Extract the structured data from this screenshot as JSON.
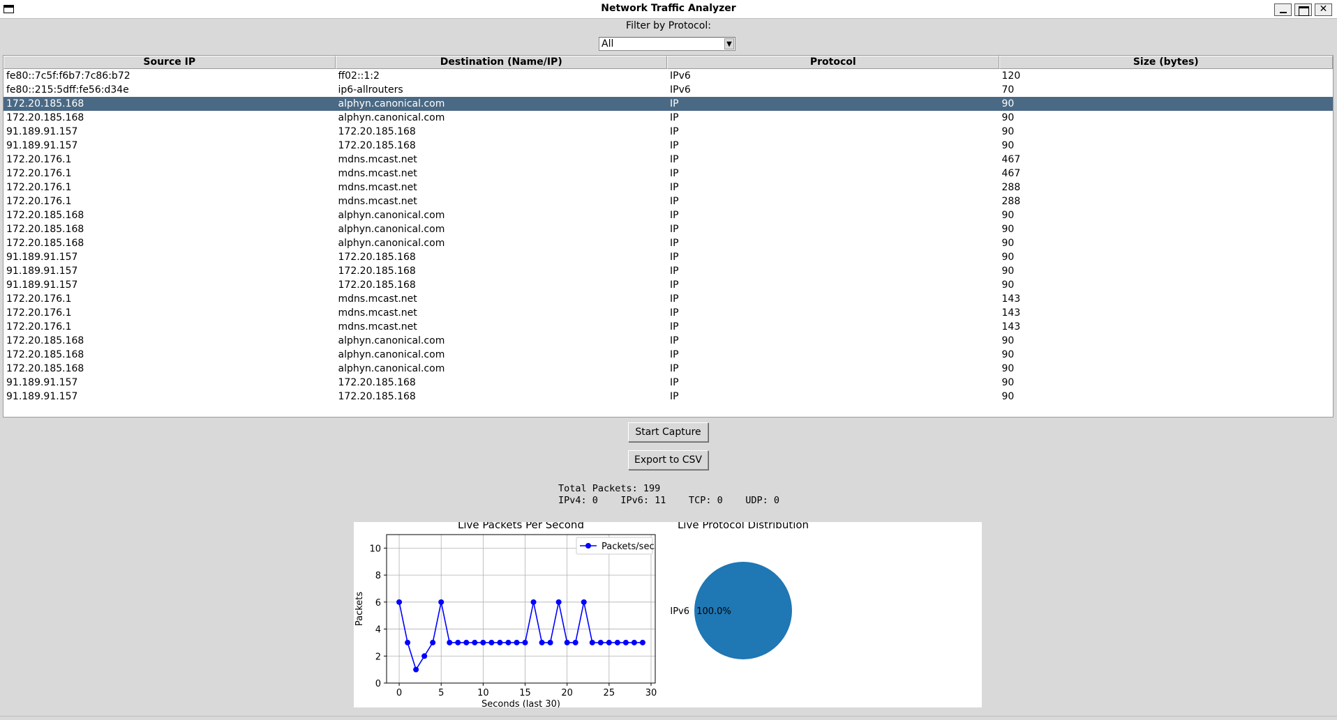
{
  "window": {
    "title": "Network Traffic Analyzer"
  },
  "filter": {
    "label": "Filter by Protocol:",
    "selected": "All"
  },
  "table": {
    "columns": [
      "Source IP",
      "Destination (Name/IP)",
      "Protocol",
      "Size (bytes)"
    ],
    "selected_row": 2,
    "rows": [
      [
        "fe80::7c5f:f6b7:7c86:b72",
        "ff02::1:2",
        "IPv6",
        "120"
      ],
      [
        "fe80::215:5dff:fe56:d34e",
        "ip6-allrouters",
        "IPv6",
        "70"
      ],
      [
        "172.20.185.168",
        "alphyn.canonical.com",
        "IP",
        "90"
      ],
      [
        "172.20.185.168",
        "alphyn.canonical.com",
        "IP",
        "90"
      ],
      [
        "91.189.91.157",
        "172.20.185.168",
        "IP",
        "90"
      ],
      [
        "91.189.91.157",
        "172.20.185.168",
        "IP",
        "90"
      ],
      [
        "172.20.176.1",
        "mdns.mcast.net",
        "IP",
        "467"
      ],
      [
        "172.20.176.1",
        "mdns.mcast.net",
        "IP",
        "467"
      ],
      [
        "172.20.176.1",
        "mdns.mcast.net",
        "IP",
        "288"
      ],
      [
        "172.20.176.1",
        "mdns.mcast.net",
        "IP",
        "288"
      ],
      [
        "172.20.185.168",
        "alphyn.canonical.com",
        "IP",
        "90"
      ],
      [
        "172.20.185.168",
        "alphyn.canonical.com",
        "IP",
        "90"
      ],
      [
        "172.20.185.168",
        "alphyn.canonical.com",
        "IP",
        "90"
      ],
      [
        "91.189.91.157",
        "172.20.185.168",
        "IP",
        "90"
      ],
      [
        "91.189.91.157",
        "172.20.185.168",
        "IP",
        "90"
      ],
      [
        "91.189.91.157",
        "172.20.185.168",
        "IP",
        "90"
      ],
      [
        "172.20.176.1",
        "mdns.mcast.net",
        "IP",
        "143"
      ],
      [
        "172.20.176.1",
        "mdns.mcast.net",
        "IP",
        "143"
      ],
      [
        "172.20.176.1",
        "mdns.mcast.net",
        "IP",
        "143"
      ],
      [
        "172.20.185.168",
        "alphyn.canonical.com",
        "IP",
        "90"
      ],
      [
        "172.20.185.168",
        "alphyn.canonical.com",
        "IP",
        "90"
      ],
      [
        "172.20.185.168",
        "alphyn.canonical.com",
        "IP",
        "90"
      ],
      [
        "91.189.91.157",
        "172.20.185.168",
        "IP",
        "90"
      ],
      [
        "91.189.91.157",
        "172.20.185.168",
        "IP",
        "90"
      ]
    ]
  },
  "buttons": {
    "start": "Start Capture",
    "export": "Export to CSV"
  },
  "stats": {
    "total_line": "Total Packets: 199",
    "breakdown_line": "IPv4: 0    IPv6: 11    TCP: 0    UDP: 0"
  },
  "colors": {
    "selection": "#4a6984",
    "line_series": "#0000ff",
    "pie_slice": "#1f77b4"
  },
  "chart_data": [
    {
      "type": "line",
      "title": "Live Packets Per Second",
      "xlabel": "Seconds (last 30)",
      "ylabel": "Packets",
      "x": [
        0,
        1,
        2,
        3,
        4,
        5,
        6,
        7,
        8,
        9,
        10,
        11,
        12,
        13,
        14,
        15,
        16,
        17,
        18,
        19,
        20,
        21,
        22,
        23,
        24,
        25,
        26,
        27,
        28,
        29
      ],
      "series": [
        {
          "name": "Packets/sec",
          "values": [
            6,
            3,
            1,
            2,
            3,
            6,
            3,
            3,
            3,
            3,
            3,
            3,
            3,
            3,
            3,
            3,
            6,
            3,
            3,
            6,
            3,
            3,
            6,
            3,
            3,
            3,
            3,
            3,
            3,
            3
          ]
        }
      ],
      "xlim": [
        -1.5,
        30.5
      ],
      "ylim": [
        0,
        11
      ],
      "xticks": [
        0,
        5,
        10,
        15,
        20,
        25,
        30
      ],
      "yticks": [
        0,
        2,
        4,
        6,
        8,
        10
      ],
      "grid": true,
      "legend": "top-right"
    },
    {
      "type": "pie",
      "title": "Live Protocol Distribution",
      "labels": [
        "IPv6"
      ],
      "values": [
        100.0
      ],
      "pct_labels": [
        "100.0%"
      ]
    }
  ]
}
